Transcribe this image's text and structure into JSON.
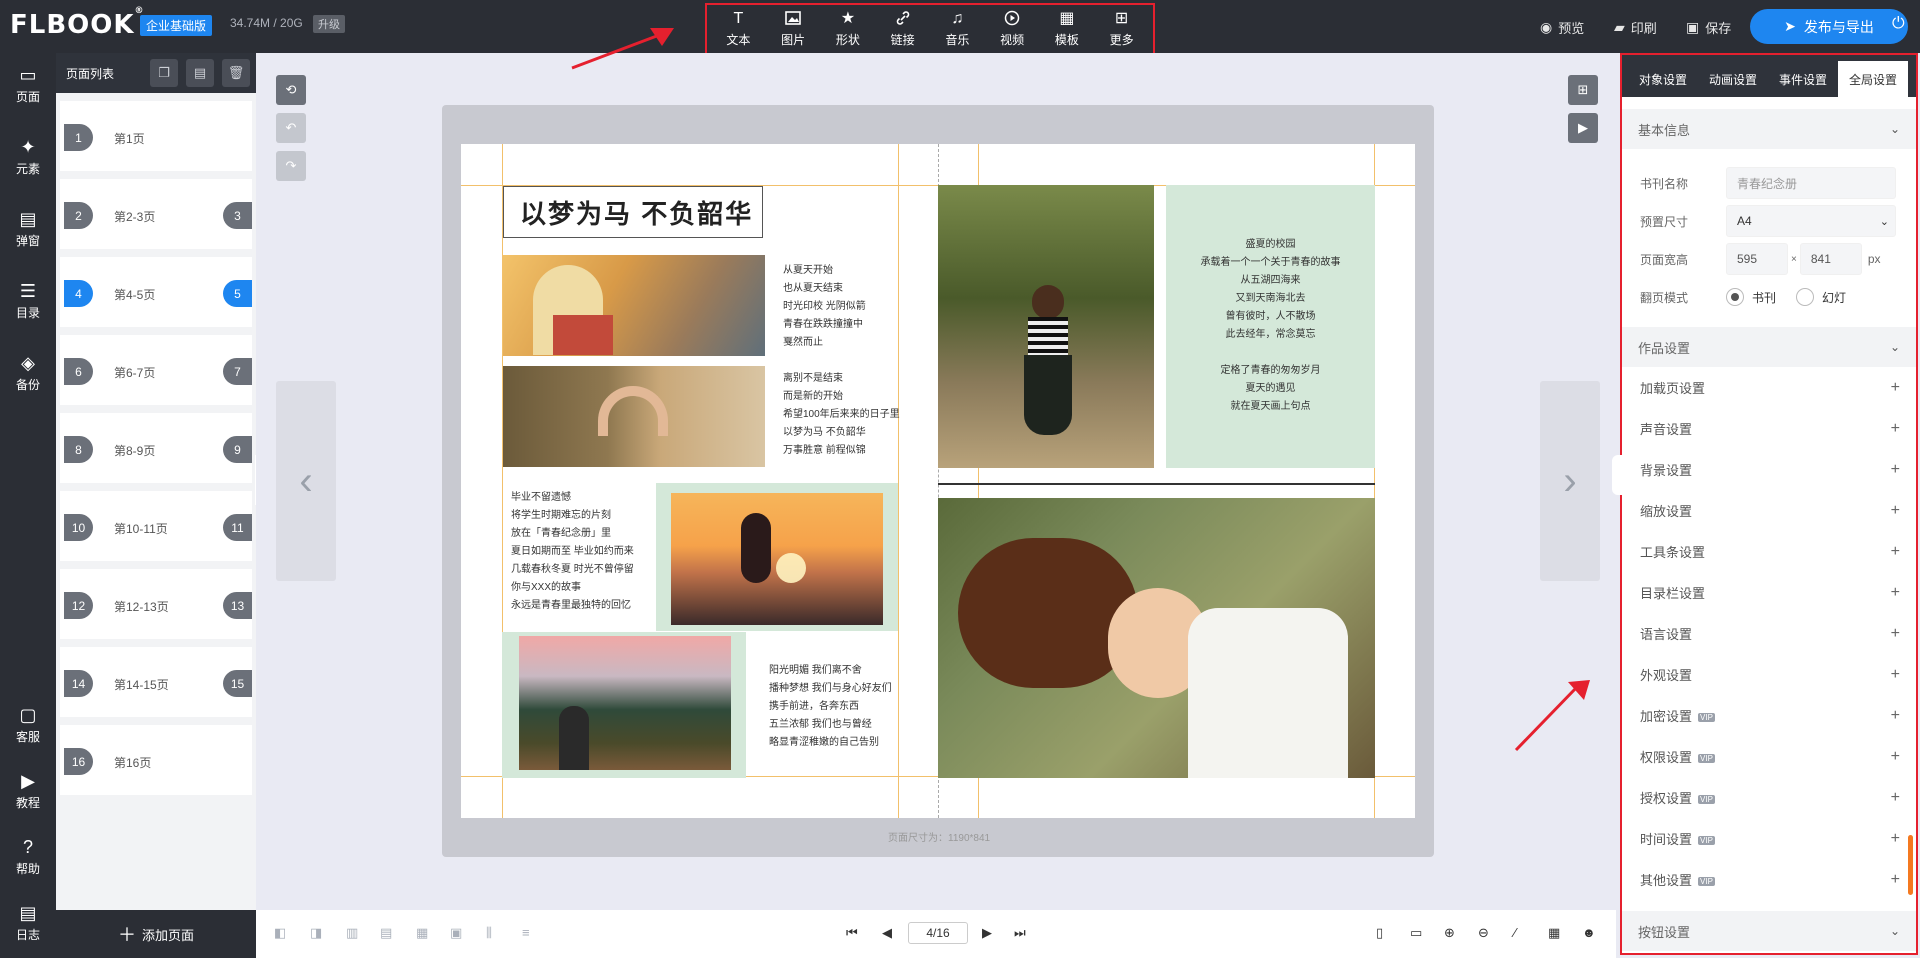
{
  "header": {
    "logo": "FLBOOK",
    "edition": "企业基础版",
    "storage": "34.74M / 20G",
    "upgrade": "升级",
    "tools": [
      {
        "label": "文本",
        "icon": "text-icon",
        "glyph": "T"
      },
      {
        "label": "图片",
        "icon": "image-icon",
        "glyph": "🖼"
      },
      {
        "label": "形状",
        "icon": "star-icon",
        "glyph": "★"
      },
      {
        "label": "链接",
        "icon": "link-icon",
        "glyph": "🔗"
      },
      {
        "label": "音乐",
        "icon": "music-icon",
        "glyph": "♫"
      },
      {
        "label": "视频",
        "icon": "video-icon",
        "glyph": "▶"
      },
      {
        "label": "模板",
        "icon": "template-icon",
        "glyph": "▦"
      },
      {
        "label": "更多",
        "icon": "more-icon",
        "glyph": "⊞"
      }
    ],
    "preview": "预览",
    "print": "印刷",
    "save": "保存",
    "publish": "发布与导出"
  },
  "leftnav": {
    "items": [
      {
        "label": "页面",
        "icon": "page-icon",
        "glyph": "▭"
      },
      {
        "label": "元素",
        "icon": "element-icon",
        "glyph": "✦"
      },
      {
        "label": "弹窗",
        "icon": "popup-icon",
        "glyph": "▤"
      },
      {
        "label": "目录",
        "icon": "list-icon",
        "glyph": "☰"
      },
      {
        "label": "备份",
        "icon": "backup-icon",
        "glyph": "◈"
      }
    ],
    "bottom": [
      {
        "label": "客服",
        "icon": "chat-icon",
        "glyph": "▢"
      },
      {
        "label": "教程",
        "icon": "play-circle-icon",
        "glyph": "▶"
      },
      {
        "label": "帮助",
        "icon": "help-icon",
        "glyph": "?"
      },
      {
        "label": "日志",
        "icon": "log-icon",
        "glyph": "▤"
      }
    ]
  },
  "pagelist": {
    "title": "页面列表",
    "items": [
      {
        "left": "1",
        "name": "第1页",
        "right": ""
      },
      {
        "left": "2",
        "name": "第2-3页",
        "right": "3"
      },
      {
        "left": "4",
        "name": "第4-5页",
        "right": "5",
        "active": true
      },
      {
        "left": "6",
        "name": "第6-7页",
        "right": "7"
      },
      {
        "left": "8",
        "name": "第8-9页",
        "right": "9"
      },
      {
        "left": "10",
        "name": "第10-11页",
        "right": "11"
      },
      {
        "left": "12",
        "name": "第12-13页",
        "right": "13"
      },
      {
        "left": "14",
        "name": "第14-15页",
        "right": "15"
      },
      {
        "left": "16",
        "name": "第16页",
        "right": ""
      }
    ],
    "add_page": "添加页面"
  },
  "canvas": {
    "title_text": "以梦为马 不负韶华",
    "poem_1": "从夏天开始\n也从夏天结束\n时光印校 光阴似箭\n青春在跌跌撞撞中\n戛然而止",
    "poem_2": "离别不是结束\n而是新的开始\n希望100年后来来的日子里\n以梦为马 不负韶华\n万事胜意 前程似锦",
    "poem_3": "毕业不留遗憾\n将学生时期难忘的片刻\n放在「青春纪念册」里\n夏日如期而至 毕业如约而来\n几载春秋冬夏 时光不曾停留\n你与XXX的故事\n永远是青春里最独特的回忆",
    "poem_4": "阳光明媚 我们离不舍\n播种梦想 我们与身心好友们\n携手前进，各奔东西\n五兰浓郁 我们也与曾经\n略显青涩稚嫩的自己告别",
    "poem_5": "盛夏的校园\n承载着一个一个关于青春的故事\n从五湖四海来\n又到天南海北去\n曾有彼时，人不散场\n此去经年，常念莫忘\n\n定格了青春的匆匆岁月\n夏天的遇见\n就在夏天画上句点",
    "size_note": "页面尺寸为：1190*841"
  },
  "bottombar": {
    "page_indicator": "4/16"
  },
  "rightpanel": {
    "tabs": [
      "对象设置",
      "动画设置",
      "事件设置",
      "全局设置"
    ],
    "active_tab": 3,
    "basic_info": "基本信息",
    "book_name_label": "书刊名称",
    "book_name_placeholder": "青春纪念册",
    "preset_size_label": "预置尺寸",
    "preset_size_value": "A4",
    "page_wh_label": "页面宽高",
    "page_width": "595",
    "page_height": "841",
    "times": "×",
    "unit": "px",
    "flip_mode_label": "翻页模式",
    "flip_book": "书刊",
    "flip_slide": "幻灯",
    "work_settings": "作品设置",
    "settings": [
      {
        "label": "加载页设置",
        "vip": false
      },
      {
        "label": "声音设置",
        "vip": false
      },
      {
        "label": "背景设置",
        "vip": false
      },
      {
        "label": "缩放设置",
        "vip": false
      },
      {
        "label": "工具条设置",
        "vip": false
      },
      {
        "label": "目录栏设置",
        "vip": false
      },
      {
        "label": "语言设置",
        "vip": false
      },
      {
        "label": "外观设置",
        "vip": false
      },
      {
        "label": "加密设置",
        "vip": true
      },
      {
        "label": "权限设置",
        "vip": true
      },
      {
        "label": "授权设置",
        "vip": true
      },
      {
        "label": "时间设置",
        "vip": true
      },
      {
        "label": "其他设置",
        "vip": true
      }
    ],
    "vip_tag": "VIP",
    "button_settings": "按钮设置"
  },
  "colors": {
    "accent": "#1e86f0",
    "dark": "#2b2e35",
    "highlight_border": "#e5202e"
  }
}
